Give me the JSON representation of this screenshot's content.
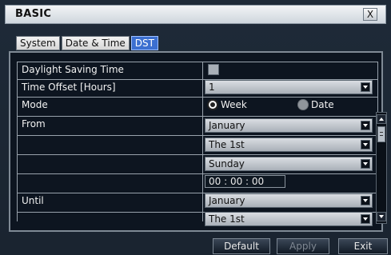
{
  "window": {
    "title": "BASIC",
    "close_label": "X"
  },
  "tabs": [
    {
      "label": "System",
      "active": false
    },
    {
      "label": "Date & Time",
      "active": false
    },
    {
      "label": "DST",
      "active": true
    }
  ],
  "form": {
    "dst_label": "Daylight Saving Time",
    "dst_checked": false,
    "offset_label": "Time Offset [Hours]",
    "offset_value": "1",
    "mode_label": "Mode",
    "mode_week_label": "Week",
    "mode_date_label": "Date",
    "mode_selected": "Week",
    "from_label": "From",
    "from_month": "January",
    "from_week": "The 1st",
    "from_day": "Sunday",
    "from_time": "00  :  00  :  00",
    "until_label": "Until",
    "until_month": "January",
    "until_week": "The 1st"
  },
  "buttons": {
    "default_label": "Default",
    "apply_label": "Apply",
    "exit_label": "Exit"
  },
  "colors": {
    "accent": "#3c6fd0",
    "panel_bg": "#0d1520",
    "window_bg": "#1a2430"
  }
}
